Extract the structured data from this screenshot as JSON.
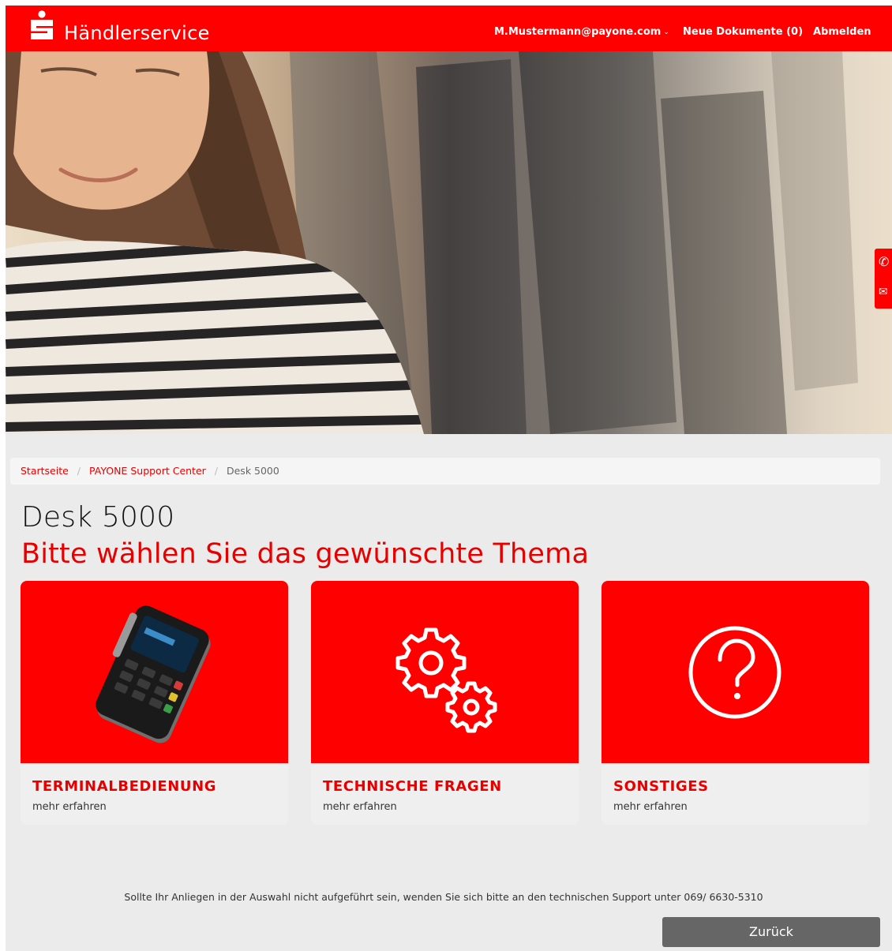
{
  "header": {
    "brand": "Händlerservice",
    "user_email": "M.Mustermann@payone.com",
    "new_documents": "Neue Dokumente (0)",
    "logout": "Abmelden"
  },
  "hero": {
    "image": "woman-in-striped-shirt-shopping-photo"
  },
  "side_contact": {
    "icons": [
      "phone-icon",
      "mail-icon"
    ]
  },
  "breadcrumb": {
    "items": [
      {
        "label": "Startseite",
        "link": true
      },
      {
        "label": "PAYONE Support Center",
        "link": true
      },
      {
        "label": "Desk 5000",
        "link": false
      }
    ]
  },
  "page": {
    "title": "Desk 5000",
    "subtitle": "Bitte wählen Sie das gewünschte Thema"
  },
  "cards": [
    {
      "title": "TERMINALBEDIENUNG",
      "link": "mehr erfahren",
      "icon": "payment-terminal-image"
    },
    {
      "title": "TECHNISCHE FRAGEN",
      "link": "mehr erfahren",
      "icon": "gears-icon"
    },
    {
      "title": "SONSTIGES",
      "link": "mehr erfahren",
      "icon": "question-circle-icon"
    }
  ],
  "footer": {
    "support_note": "Sollte Ihr Anliegen in der Auswahl nicht aufgeführt sein, wenden Sie sich bitte an den technischen Support unter 069/ 6630-5310",
    "back_button": "Zurück"
  },
  "colors": {
    "brand_red": "#ff0000",
    "text_red": "#e60000",
    "button_gray": "#666666",
    "background": "#ebebeb"
  }
}
